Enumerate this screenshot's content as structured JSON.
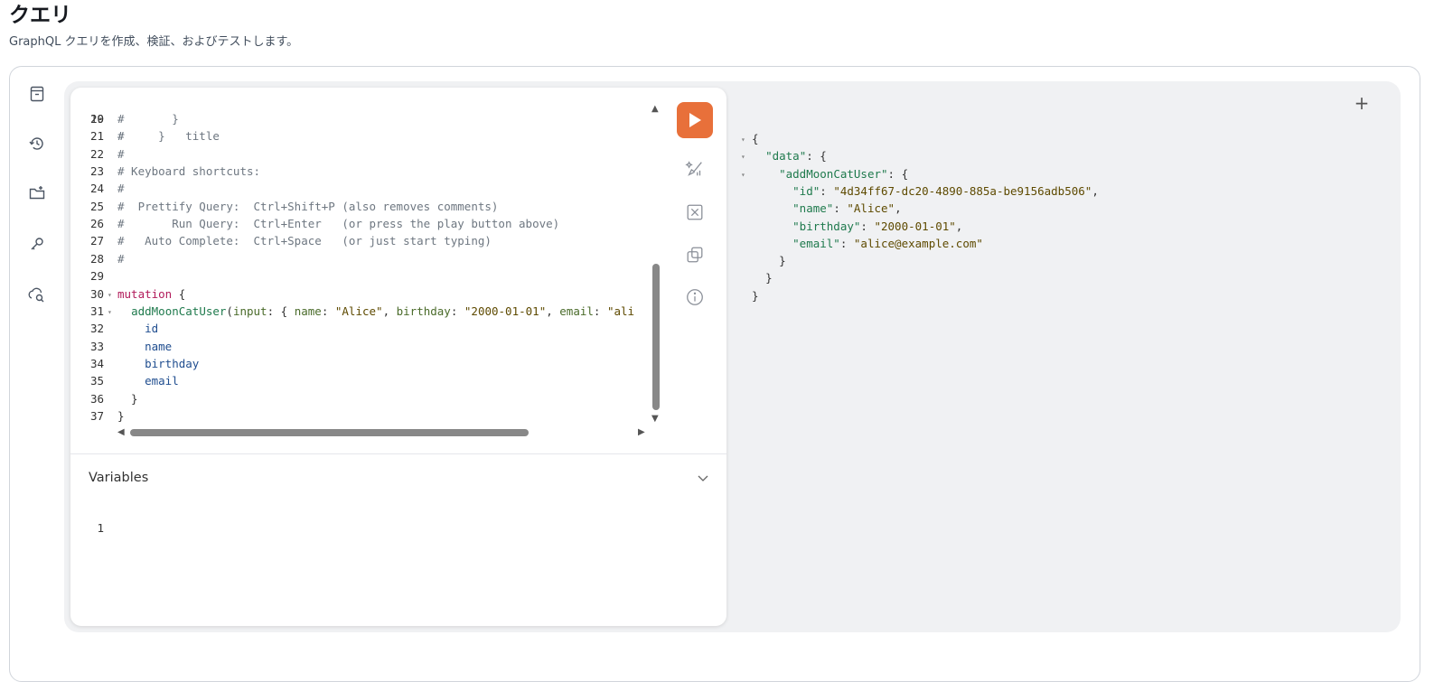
{
  "page": {
    "title": "クエリ",
    "subtitle": "GraphQL クエリを作成、検証、およびテストします。"
  },
  "sidebar": {
    "icons": [
      "documentation-icon",
      "history-icon",
      "explorer-folder-icon",
      "auth-key-icon",
      "schema-search-icon"
    ]
  },
  "editor": {
    "lines": [
      {
        "n": "20",
        "text": "#       }"
      },
      {
        "n": "21",
        "text": "#     }"
      },
      {
        "n": "22",
        "text": "#"
      },
      {
        "n": "23",
        "text": "# Keyboard shortcuts:"
      },
      {
        "n": "24",
        "text": "#"
      },
      {
        "n": "25",
        "text": "#  Prettify Query:  Ctrl+Shift+P (also removes comments)"
      },
      {
        "n": "26",
        "text": "#       Run Query:  Ctrl+Enter   (or press the play button above)"
      },
      {
        "n": "27",
        "text": "#   Auto Complete:  Ctrl+Space   (or just start typing)"
      },
      {
        "n": "28",
        "text": "#"
      },
      {
        "n": "29",
        "text": ""
      },
      {
        "n": "30",
        "keyword": "mutation",
        "rest": " {"
      },
      {
        "n": "31",
        "def": "addMoonCatUser",
        "p1": "(",
        "arg1": "input",
        "p2": ": { ",
        "arg2": "name",
        "p3": ": ",
        "s1": "\"Alice\"",
        "p4": ", ",
        "arg3": "birthday",
        "p5": ": ",
        "s2": "\"2000-01-01\"",
        "p6": ", ",
        "arg4": "email",
        "p7": ": ",
        "s3": "\"ali"
      },
      {
        "n": "32",
        "field": "id"
      },
      {
        "n": "33",
        "field": "name"
      },
      {
        "n": "34",
        "field": "birthday"
      },
      {
        "n": "35",
        "field": "email"
      },
      {
        "n": "36",
        "text": "  }"
      },
      {
        "n": "37",
        "text": "}"
      }
    ],
    "partial_top_line": {
      "n": "19",
      "text": "#         title"
    }
  },
  "toolbar": {
    "run_icon": "play-icon",
    "prettify_icon": "prettify-icon",
    "merge_icon": "merge-fragments-icon",
    "copy_icon": "copy-icon",
    "info_icon": "info-icon"
  },
  "variables": {
    "label": "Variables",
    "line_number": "1"
  },
  "result": {
    "lines": [
      {
        "fold": "▾",
        "text": "{"
      },
      {
        "fold": "▾",
        "key": "\"data\"",
        "rest": ": {"
      },
      {
        "fold": "▾",
        "key": "\"addMoonCatUser\"",
        "rest": ": {"
      },
      {
        "key": "\"id\"",
        "sep": ": ",
        "val": "\"4d34ff67-dc20-4890-885a-be9156adb506\"",
        "end": ","
      },
      {
        "key": "\"name\"",
        "sep": ": ",
        "val": "\"Alice\"",
        "end": ","
      },
      {
        "key": "\"birthday\"",
        "sep": ": ",
        "val": "\"2000-01-01\"",
        "end": ","
      },
      {
        "key": "\"email\"",
        "sep": ": ",
        "val": "\"alice@example.com\"",
        "end": ""
      },
      {
        "text": "}"
      },
      {
        "text": "}"
      },
      {
        "text": "}"
      }
    ],
    "add_tab_label": "+"
  },
  "colors": {
    "run_button": "#e8703a",
    "workspace_bg": "#f0f1f3"
  }
}
